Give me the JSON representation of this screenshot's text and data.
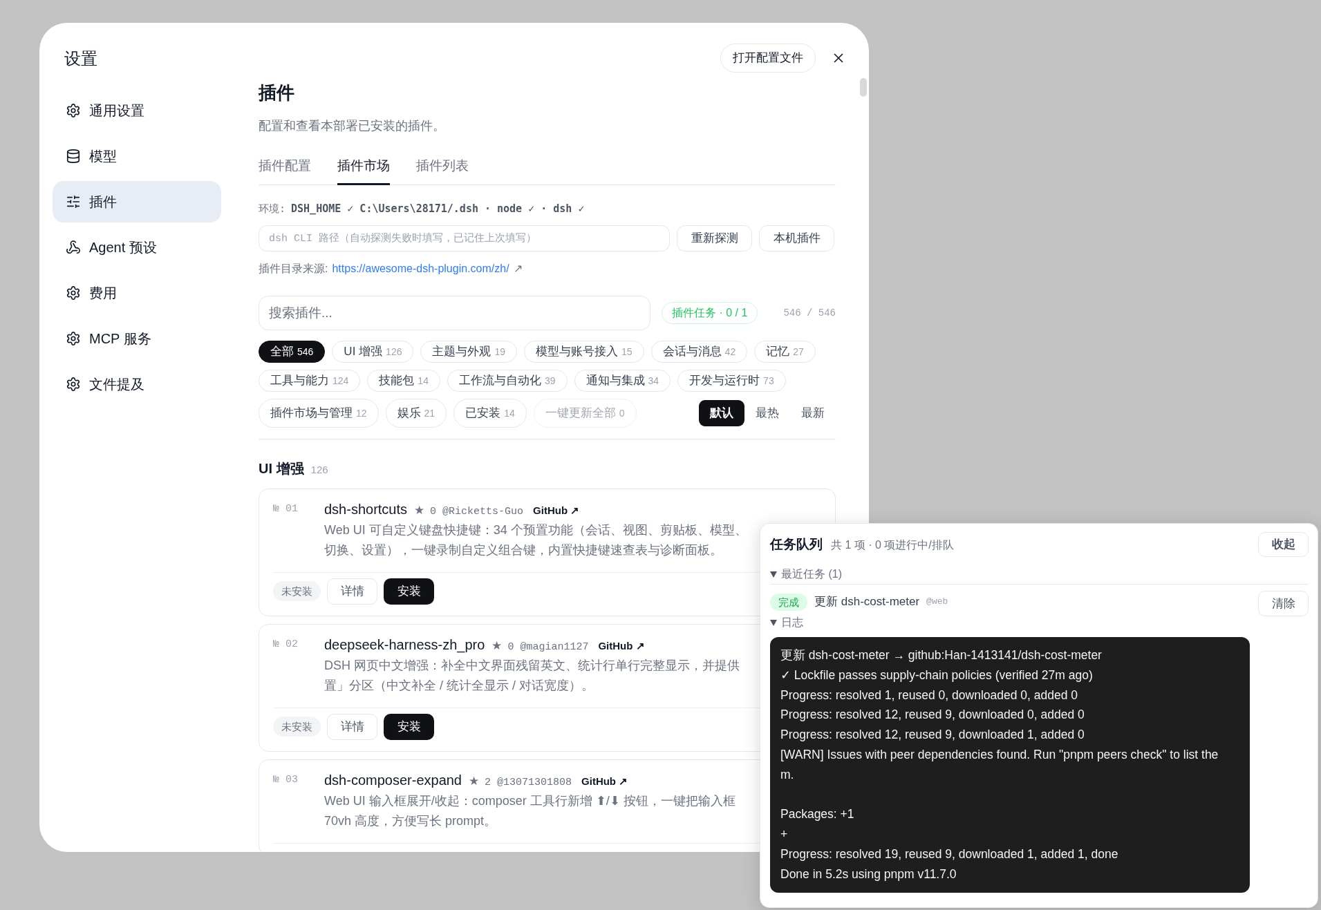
{
  "settings_nav": {
    "title": "设置",
    "items": [
      {
        "label": "通用设置",
        "selected": false
      },
      {
        "label": "模型",
        "selected": false
      },
      {
        "label": "插件",
        "selected": true
      },
      {
        "label": "Agent 预设",
        "selected": false
      },
      {
        "label": "费用",
        "selected": false
      },
      {
        "label": "MCP 服务",
        "selected": false
      },
      {
        "label": "文件提及",
        "selected": false
      }
    ]
  },
  "toolbar": {
    "open_config_button": "打开配置文件"
  },
  "page": {
    "title": "插件",
    "description": "配置和查看本部署已安装的插件。",
    "tabs": [
      {
        "label": "插件配置",
        "selected": false
      },
      {
        "label": "插件市场",
        "selected": true
      },
      {
        "label": "插件列表",
        "selected": false
      }
    ]
  },
  "environment": {
    "label": "环境:",
    "value": "DSH_HOME ✓ C:\\Users\\28171/.dsh · node ✓ · dsh ✓"
  },
  "cli_path": {
    "placeholder": "dsh CLI 路径（自动探测失败时填写，已记住上次填写）",
    "buttons": [
      "重新探测",
      "本机插件"
    ]
  },
  "catalog_source": {
    "label": "插件目录来源:",
    "url": "https://awesome-dsh-plugin.com/zh/",
    "arrow": "↗"
  },
  "search": {
    "placeholder": "搜索插件..."
  },
  "task_badge": "插件任务 · 0 / 1",
  "result_count": "546 / 546",
  "category_rows": [
    [
      {
        "label": "全部",
        "count": "546",
        "selected": true
      },
      {
        "label": "UI 增强",
        "count": "126",
        "selected": false
      },
      {
        "label": "主题与外观",
        "count": "19",
        "selected": false
      },
      {
        "label": "模型与账号接入",
        "count": "15",
        "selected": false
      },
      {
        "label": "会话与消息",
        "count": "42",
        "selected": false
      },
      {
        "label": "记忆",
        "count": "27",
        "selected": false
      }
    ],
    [
      {
        "label": "工具与能力",
        "count": "124",
        "selected": false
      },
      {
        "label": "技能包",
        "count": "14",
        "selected": false
      },
      {
        "label": "工作流与自动化",
        "count": "39",
        "selected": false
      },
      {
        "label": "通知与集成",
        "count": "34",
        "selected": false
      },
      {
        "label": "开发与运行时",
        "count": "73",
        "selected": false
      }
    ],
    [
      {
        "label": "插件市场与管理",
        "count": "12",
        "selected": false
      },
      {
        "label": "娱乐",
        "count": "21",
        "selected": false
      },
      {
        "label": "已安装",
        "count": "14",
        "selected": false
      }
    ]
  ],
  "update_all": {
    "label": "一键更新全部",
    "count": "0",
    "disabled": true
  },
  "sort": [
    {
      "label": "默认",
      "selected": true
    },
    {
      "label": "最热",
      "selected": false
    },
    {
      "label": "最新",
      "selected": false
    }
  ],
  "section": {
    "title": "UI 增强",
    "count": "126",
    "plugins": [
      {
        "number": "№ 01",
        "name": "dsh-shortcuts",
        "star": "★",
        "star_count": "0",
        "author": "@Ricketts-Guo",
        "link": "GitHub ↗",
        "description_lines": [
          "Web UI 可自定义键盘快捷键：34 个预置功能（会话、视图、剪贴板、模型、",
          "切换、设置），一键录制自定义组合键，内置快捷键速查表与诊断面板。"
        ],
        "status": "未安装",
        "details_button": "详情",
        "install_button": "安装"
      },
      {
        "number": "№ 02",
        "name": "deepseek-harness-zh_pro",
        "star": "★",
        "star_count": "0",
        "author": "@magian1127",
        "link": "GitHub ↗",
        "description_lines": [
          "DSH 网页中文增强：补全中文界面残留英文、统计行单行完整显示，并提供",
          "置」分区（中文补全 / 统计全显示 / 对话宽度）。"
        ],
        "status": "未安装",
        "details_button": "详情",
        "install_button": "安装"
      },
      {
        "number": "№ 03",
        "name": "dsh-composer-expand",
        "star": "★",
        "star_count": "2",
        "author": "@13071301808",
        "link": "GitHub ↗",
        "description_lines": [
          "Web UI 输入框展开/收起：composer 工具行新增 ⬆/⬇ 按钮，一键把输入框",
          "70vh 高度，方便写长 prompt。"
        ]
      }
    ]
  },
  "task_queue": {
    "title": "任务队列",
    "summary": "共 1 项 · 0 项进行中/排队",
    "collapse_button": "收起",
    "recent_label": "最近任务 (1)",
    "recent_expanded": true,
    "tasks": [
      {
        "complete": true,
        "status": "完成",
        "title": "更新 dsh-cost-meter",
        "source": "@web",
        "clear_button": "清除",
        "log_label": "日志",
        "log_expanded": true,
        "log": "更新 dsh-cost-meter → github:Han-1413141/dsh-cost-meter\n✓ Lockfile passes supply-chain policies (verified 27m ago)\nProgress: resolved 1, reused 0, downloaded 0, added 0\nProgress: resolved 12, reused 9, downloaded 0, added 0\nProgress: resolved 12, reused 9, downloaded 1, added 0\n[WARN] Issues with peer dependencies found. Run \"pnpm peers check\" to list them.\n\nPackages: +1\n+\nProgress: resolved 19, reused 9, downloaded 1, added 1, done\nDone in 5.2s using pnpm v11.7.0"
      }
    ]
  }
}
